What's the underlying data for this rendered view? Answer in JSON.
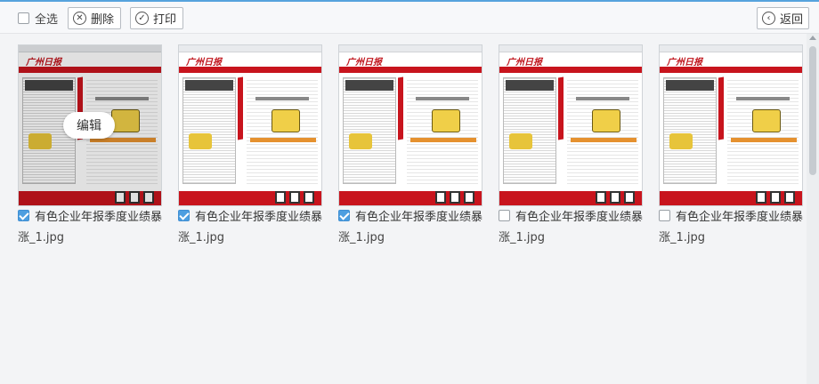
{
  "toolbar": {
    "select_all_label": "全选",
    "delete_label": "删除",
    "print_label": "打印",
    "back_label": "返回"
  },
  "cards": [
    {
      "title": "有色企业年报季度业绩暴",
      "file": "涨_1.jpg",
      "checked": true,
      "edit_label": "编辑",
      "masthead": "广州日报"
    },
    {
      "title": "有色企业年报季度业绩暴",
      "file": "涨_1.jpg",
      "checked": true,
      "masthead": "广州日报"
    },
    {
      "title": "有色企业年报季度业绩暴",
      "file": "涨_1.jpg",
      "checked": true,
      "masthead": "广州日报"
    },
    {
      "title": "有色企业年报季度业绩暴",
      "file": "涨_1.jpg",
      "checked": false,
      "masthead": "广州日报"
    },
    {
      "title": "有色企业年报季度业绩暴",
      "file": "涨_1.jpg",
      "checked": false,
      "masthead": "广州日报"
    }
  ],
  "colors": {
    "accent": "#4d9ee0",
    "newspaper_red": "#c8141d"
  },
  "icons": {
    "delete": "close-circle-icon",
    "print": "check-circle-icon",
    "back": "chevron-left-circle-icon"
  }
}
